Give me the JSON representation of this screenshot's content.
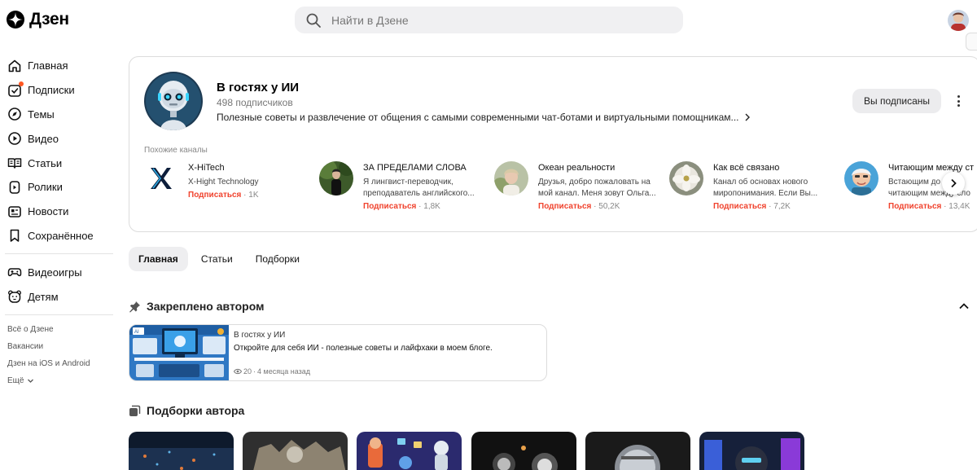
{
  "header": {
    "logo_text": "Дзен",
    "search_placeholder": "Найти в Дзене"
  },
  "sidebar": {
    "items": [
      {
        "label": "Главная",
        "icon": "home-icon"
      },
      {
        "label": "Подписки",
        "icon": "subscriptions-icon"
      },
      {
        "label": "Темы",
        "icon": "compass-icon"
      },
      {
        "label": "Видео",
        "icon": "video-icon"
      },
      {
        "label": "Статьи",
        "icon": "book-icon"
      },
      {
        "label": "Ролики",
        "icon": "clips-icon"
      },
      {
        "label": "Новости",
        "icon": "news-icon"
      },
      {
        "label": "Сохранённое",
        "icon": "bookmark-icon"
      }
    ],
    "extra_items": [
      {
        "label": "Видеоигры",
        "icon": "gamepad-icon"
      },
      {
        "label": "Детям",
        "icon": "kids-icon"
      }
    ],
    "footer_links": [
      "Всё о Дзене",
      "Вакансии",
      "Дзен на iOS и Android",
      "Ещё"
    ]
  },
  "channel": {
    "title": "В гостях у ИИ",
    "subscribers": "498 подписчиков",
    "description": "Полезные советы и развлечение от общения с самыми современными чат-ботами и виртуальными помощникам...",
    "subscribe_label": "Вы подписаны",
    "similar_title": "Похожие каналы",
    "similar": [
      {
        "name": "X-HiTech",
        "desc": [
          "X-Hight Technology"
        ],
        "subscribe": "Подписаться",
        "count": "1K"
      },
      {
        "name": "ЗА ПРЕДЕЛАМИ СЛОВА",
        "desc": [
          "Я лингвист-переводчик,",
          "преподаватель английского..."
        ],
        "subscribe": "Подписаться",
        "count": "1,8K"
      },
      {
        "name": "Океан реальности",
        "desc": [
          "Друзья, добро пожаловать на",
          "мой канал. Меня зовут Ольга..."
        ],
        "subscribe": "Подписаться",
        "count": "50,2K"
      },
      {
        "name": "Как всё связано",
        "desc": [
          "Канал об основах нового",
          "миропонимания. Если Вы..."
        ],
        "subscribe": "Подписаться",
        "count": "7,2K"
      },
      {
        "name": "Читающим между ст",
        "desc": [
          "Встающим до",
          "читающим между сло"
        ],
        "subscribe": "Подписаться",
        "count": "13,4K"
      }
    ]
  },
  "tabs": [
    {
      "label": "Главная",
      "active": true
    },
    {
      "label": "Статьи",
      "active": false
    },
    {
      "label": "Подборки",
      "active": false
    }
  ],
  "pinned": {
    "section_title": "Закреплено автором",
    "channel": "В гостях у ИИ",
    "headline": "Откройте для себя ИИ - полезные советы и лайфхаки в моем блоге.",
    "views": "20",
    "age": "4 месяца назад"
  },
  "collections": {
    "section_title": "Подборки автора"
  },
  "colors": {
    "accent": "#f0432e",
    "badge": "#ff5722",
    "search_bg": "#f0f0f2",
    "button_bg": "#ececee"
  }
}
